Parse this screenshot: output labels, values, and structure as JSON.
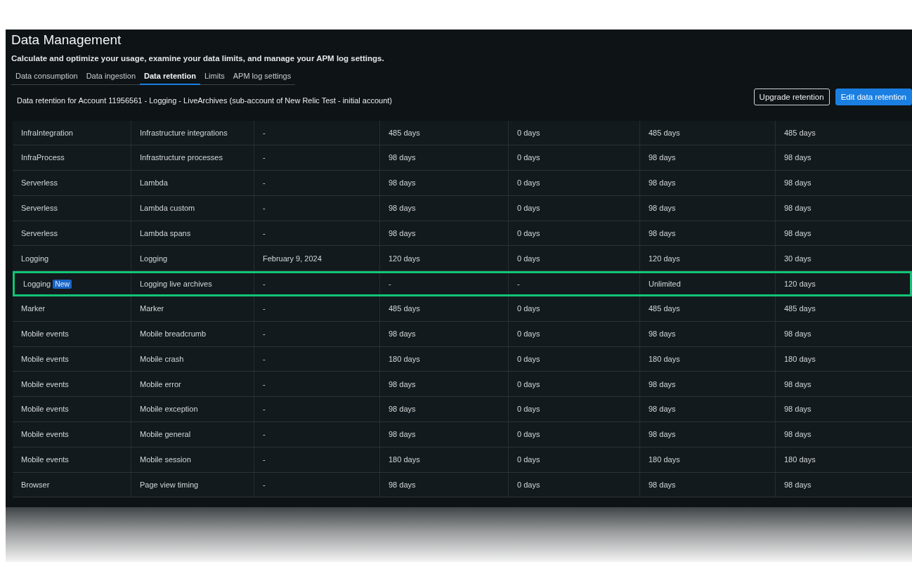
{
  "page": {
    "title": "Data Management",
    "subtitle": "Calculate and optimize your usage, examine your data limits, and manage your APM log settings."
  },
  "tabs": [
    {
      "label": "Data consumption",
      "selected": false
    },
    {
      "label": "Data ingestion",
      "selected": false
    },
    {
      "label": "Data retention",
      "selected": true
    },
    {
      "label": "Limits",
      "selected": false
    },
    {
      "label": "APM log settings",
      "selected": false
    }
  ],
  "account_heading": "Data retention for Account 11956561 - Logging - LiveArchives (sub-account of New Relic Test - initial account)",
  "buttons": [
    {
      "label": "Upgrade retention",
      "kind": "outline"
    },
    {
      "label": "Edit data retention",
      "kind": "primary"
    }
  ],
  "table": {
    "rows": [
      {
        "column_1": "InfraIntegration",
        "column_2": "Infrastructure integrations",
        "column_3": "-",
        "column_4": "485 days",
        "column_5": "0 days",
        "column_6": "485 days",
        "column_7": "485 days",
        "highlighted": false
      },
      {
        "column_1": "InfraProcess",
        "column_2": "Infrastructure processes",
        "column_3": "-",
        "column_4": "98 days",
        "column_5": "0 days",
        "column_6": "98 days",
        "column_7": "98 days",
        "highlighted": false
      },
      {
        "column_1": "Serverless",
        "column_2": "Lambda",
        "column_3": "-",
        "column_4": "98 days",
        "column_5": "0 days",
        "column_6": "98 days",
        "column_7": "98 days",
        "highlighted": false
      },
      {
        "column_1": "Serverless",
        "column_2": "Lambda custom",
        "column_3": "-",
        "column_4": "98 days",
        "column_5": "0 days",
        "column_6": "98 days",
        "column_7": "98 days",
        "highlighted": false
      },
      {
        "column_1": "Serverless",
        "column_2": "Lambda spans",
        "column_3": "-",
        "column_4": "98 days",
        "column_5": "0 days",
        "column_6": "98 days",
        "column_7": "98 days",
        "highlighted": false
      },
      {
        "column_1": "Logging",
        "column_2": "Logging",
        "column_3": "February 9, 2024",
        "column_4": "120 days",
        "column_5": "0 days",
        "column_6": "120 days",
        "column_7": "30 days",
        "highlighted": false
      },
      {
        "column_1": "Logging",
        "badge": "New",
        "column_2": "Logging live archives",
        "column_3": "-",
        "column_4": "-",
        "column_5": "-",
        "column_6": "Unlimited",
        "column_7": "120 days",
        "highlighted": true
      },
      {
        "column_1": "Marker",
        "column_2": "Marker",
        "column_3": "-",
        "column_4": "485 days",
        "column_5": "0 days",
        "column_6": "485 days",
        "column_7": "485 days",
        "highlighted": false
      },
      {
        "column_1": "Mobile events",
        "column_2": "Mobile breadcrumb",
        "column_3": "-",
        "column_4": "98 days",
        "column_5": "0 days",
        "column_6": "98 days",
        "column_7": "98 days",
        "highlighted": false
      },
      {
        "column_1": "Mobile events",
        "column_2": "Mobile crash",
        "column_3": "-",
        "column_4": "180 days",
        "column_5": "0 days",
        "column_6": "180 days",
        "column_7": "180 days",
        "highlighted": false
      },
      {
        "column_1": "Mobile events",
        "column_2": "Mobile error",
        "column_3": "-",
        "column_4": "98 days",
        "column_5": "0 days",
        "column_6": "98 days",
        "column_7": "98 days",
        "highlighted": false
      },
      {
        "column_1": "Mobile events",
        "column_2": "Mobile exception",
        "column_3": "-",
        "column_4": "98 days",
        "column_5": "0 days",
        "column_6": "98 days",
        "column_7": "98 days",
        "highlighted": false
      },
      {
        "column_1": "Mobile events",
        "column_2": "Mobile general",
        "column_3": "-",
        "column_4": "98 days",
        "column_5": "0 days",
        "column_6": "98 days",
        "column_7": "98 days",
        "highlighted": false
      },
      {
        "column_1": "Mobile events",
        "column_2": "Mobile session",
        "column_3": "-",
        "column_4": "180 days",
        "column_5": "0 days",
        "column_6": "180 days",
        "column_7": "180 days",
        "highlighted": false
      },
      {
        "column_1": "Browser",
        "column_2": "Page view timing",
        "column_3": "-",
        "column_4": "98 days",
        "column_5": "0 days",
        "column_6": "98 days",
        "column_7": "98 days",
        "highlighted": false
      }
    ]
  }
}
